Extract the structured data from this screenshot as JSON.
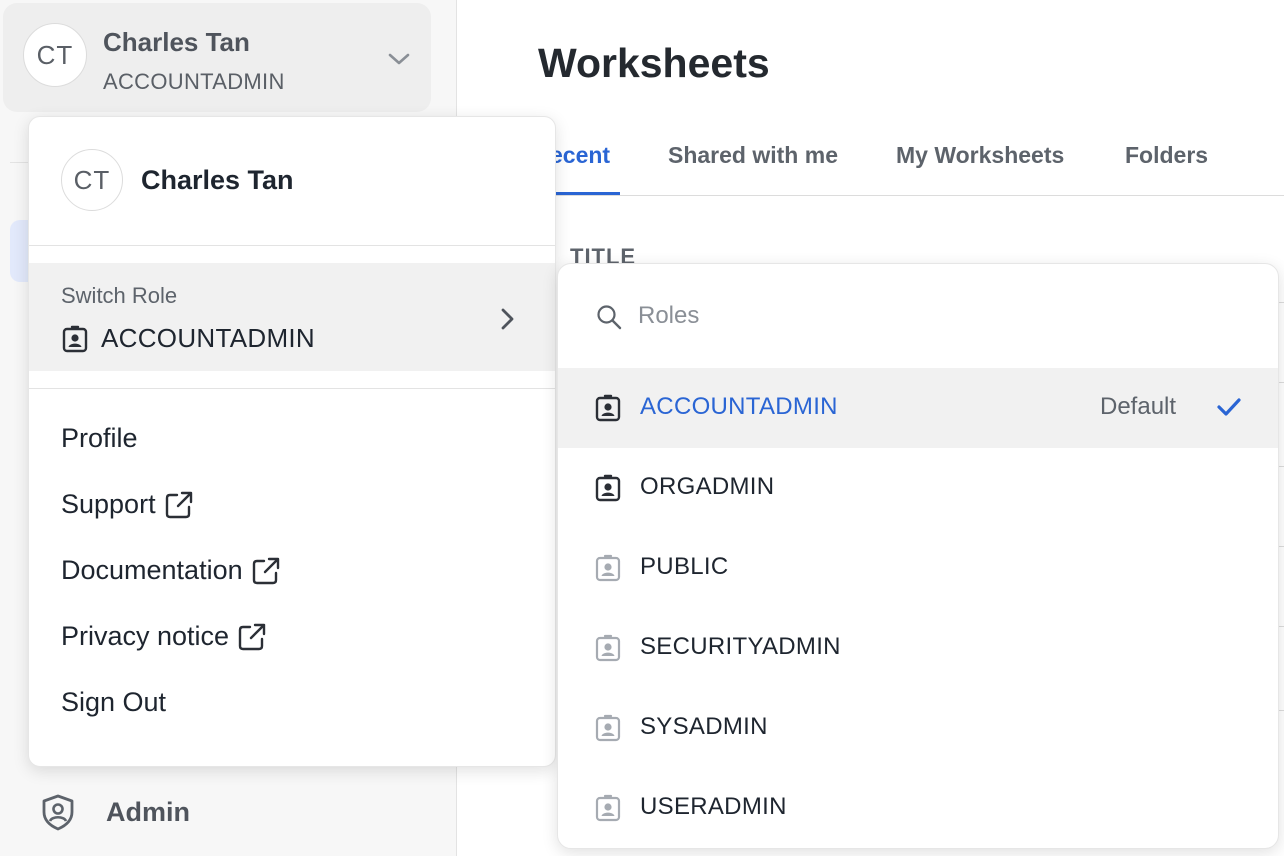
{
  "sidebar": {
    "user": {
      "initials": "CT",
      "name": "Charles Tan",
      "role": "ACCOUNTADMIN"
    },
    "admin_label": "Admin"
  },
  "main": {
    "title": "Worksheets",
    "tabs": [
      {
        "label": "ecent",
        "active": true
      },
      {
        "label": "Shared with me",
        "active": false
      },
      {
        "label": "My Worksheets",
        "active": false
      },
      {
        "label": "Folders",
        "active": false
      }
    ],
    "column_header": "TITLE"
  },
  "user_menu": {
    "initials": "CT",
    "name": "Charles Tan",
    "switch_role_label": "Switch Role",
    "current_role": "ACCOUNTADMIN",
    "items": [
      {
        "label": "Profile",
        "external": false
      },
      {
        "label": "Support",
        "external": true
      },
      {
        "label": "Documentation",
        "external": true
      },
      {
        "label": "Privacy notice",
        "external": true
      },
      {
        "label": "Sign Out",
        "external": false
      }
    ]
  },
  "roles_panel": {
    "search_placeholder": "Roles",
    "default_label": "Default",
    "roles": [
      {
        "name": "ACCOUNTADMIN",
        "selected": true,
        "default": true,
        "icon_style": "dark"
      },
      {
        "name": "ORGADMIN",
        "selected": false,
        "default": false,
        "icon_style": "dark"
      },
      {
        "name": "PUBLIC",
        "selected": false,
        "default": false,
        "icon_style": "light"
      },
      {
        "name": "SECURITYADMIN",
        "selected": false,
        "default": false,
        "icon_style": "light"
      },
      {
        "name": "SYSADMIN",
        "selected": false,
        "default": false,
        "icon_style": "light"
      },
      {
        "name": "USERADMIN",
        "selected": false,
        "default": false,
        "icon_style": "light"
      }
    ]
  },
  "colors": {
    "accent": "#2a65d4",
    "selected_row_bg": "#f1f1f1",
    "text_primary": "#1e252f",
    "text_secondary": "#5d636b"
  },
  "icons": {
    "role_icon": "id-badge-icon",
    "external_link_icon": "external-link-icon",
    "search_icon": "search-icon",
    "check_icon": "checkmark-icon",
    "chevron_down_icon": "chevron-down-icon",
    "chevron_right_icon": "chevron-right-icon",
    "admin_icon": "shield-user-icon"
  }
}
